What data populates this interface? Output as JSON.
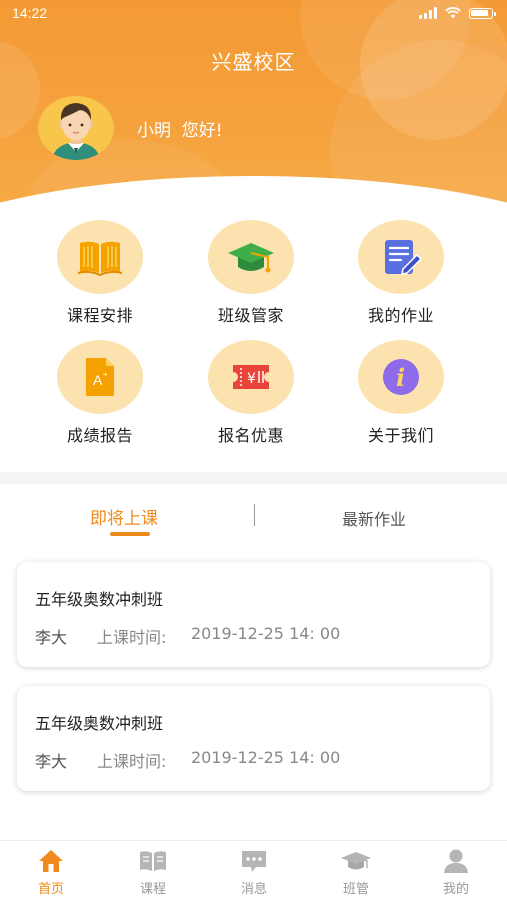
{
  "status_bar": {
    "time": "14:22"
  },
  "header": {
    "campus_name": "兴盛校区",
    "greeting": "小明  您好!"
  },
  "menu": [
    {
      "label": "课程安排",
      "icon": "book-icon"
    },
    {
      "label": "班级管家",
      "icon": "graduation-cap-icon"
    },
    {
      "label": "我的作业",
      "icon": "homework-edit-icon"
    },
    {
      "label": "成绩报告",
      "icon": "report-document-icon"
    },
    {
      "label": "报名优惠",
      "icon": "discount-ticket-icon"
    },
    {
      "label": "关于我们",
      "icon": "info-icon"
    }
  ],
  "tabs": {
    "active": "即将上课",
    "inactive": "最新作业"
  },
  "courses": [
    {
      "name": "五年级奥数冲刺班",
      "teacher": "李大",
      "time_label": "上课时间:",
      "time": "2019-12-25 14: 00"
    },
    {
      "name": "五年级奥数冲刺班",
      "teacher": "李大",
      "time_label": "上课时间:",
      "time": "2019-12-25 14: 00"
    }
  ],
  "bottom_nav": [
    {
      "label": "首页",
      "icon": "home-icon",
      "active": true
    },
    {
      "label": "课程",
      "icon": "course-book-icon",
      "active": false
    },
    {
      "label": "消息",
      "icon": "message-icon",
      "active": false
    },
    {
      "label": "班管",
      "icon": "class-cap-icon",
      "active": false
    },
    {
      "label": "我的",
      "icon": "user-icon",
      "active": false
    }
  ],
  "colors": {
    "header_orange": "#F49A34",
    "accent": "#F08A1C",
    "icon_bg": "#FCE2AE",
    "inactive_gray": "#999999"
  }
}
